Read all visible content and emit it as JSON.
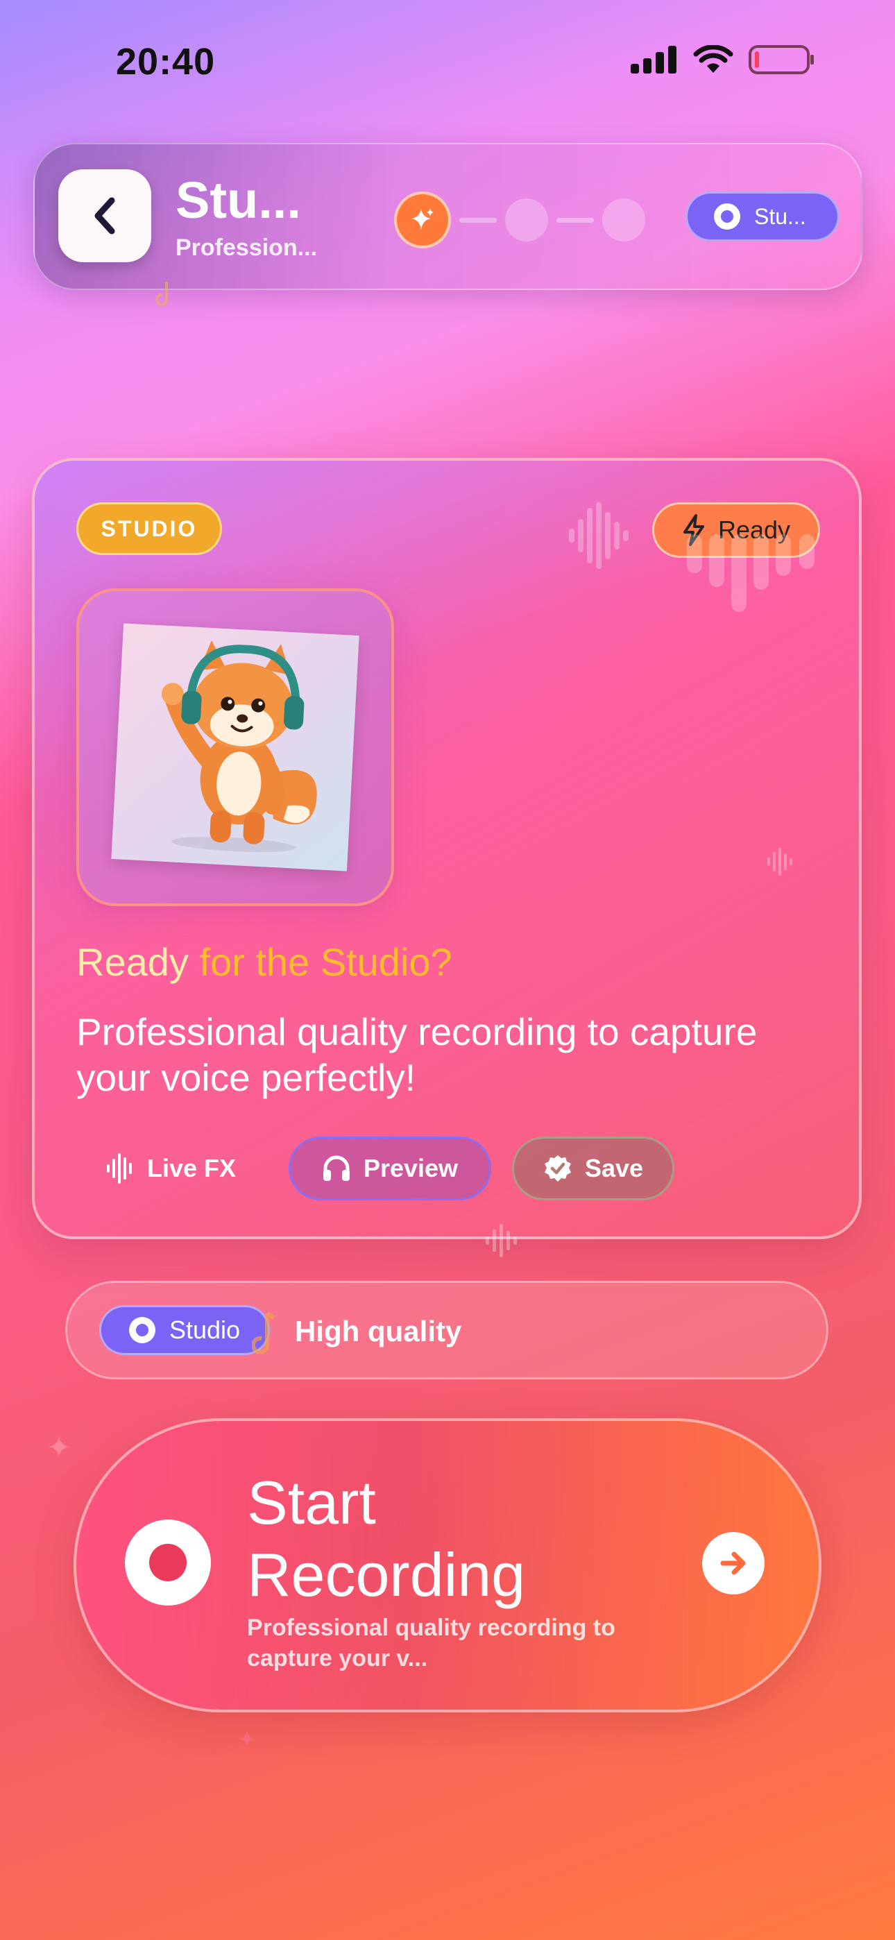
{
  "status_bar": {
    "time": "20:40"
  },
  "header": {
    "title": "Stu...",
    "subtitle": "Profession...",
    "chip_label": "Stu..."
  },
  "card": {
    "badge": "STUDIO",
    "ready_label": "Ready",
    "title_part1": "Ready ",
    "title_part2": "for the Studio?",
    "description": "Professional quality recording to capture your voice perfectly!",
    "actions": {
      "live_fx": "Live FX",
      "preview": "Preview",
      "save": "Save"
    }
  },
  "quality_bar": {
    "chip_label": "Studio",
    "text": "High quality"
  },
  "record": {
    "title": "Start Recording",
    "subtitle": "Professional quality recording to capture your v..."
  },
  "colors": {
    "accent_purple": "#7b63f5",
    "accent_orange": "#ff7a3a",
    "studio_badge": "#f2a82a",
    "record_red": "#ea3a5a"
  }
}
